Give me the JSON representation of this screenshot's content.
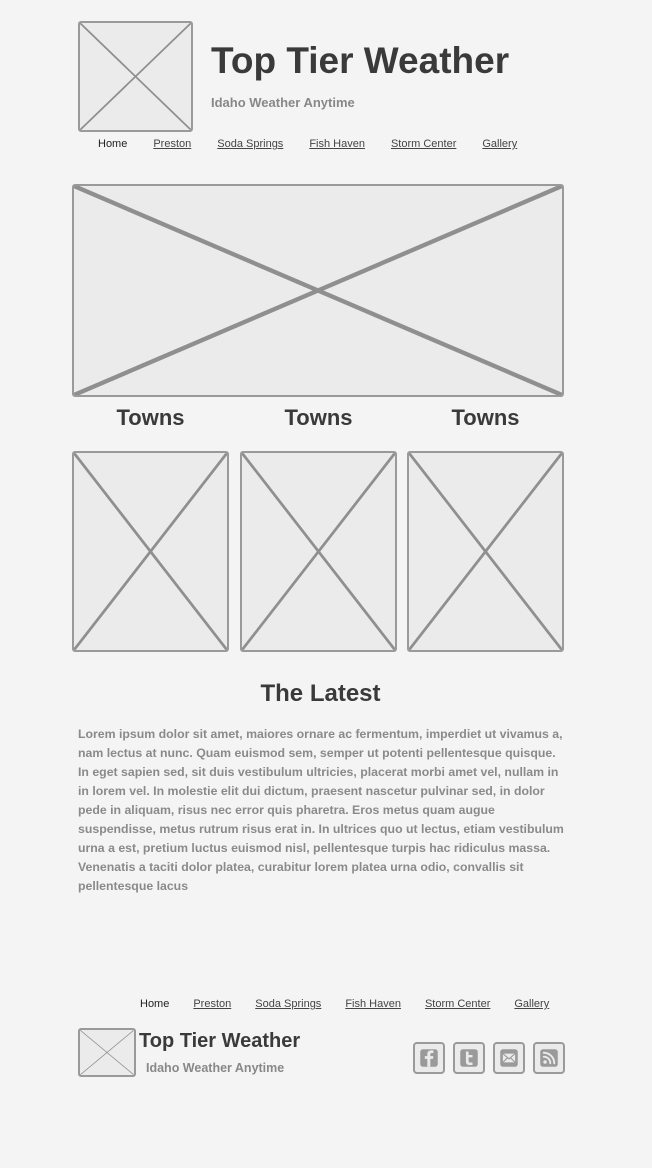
{
  "header": {
    "title": "Top Tier Weather",
    "subtitle": "Idaho Weather Anytime"
  },
  "nav": {
    "items": [
      "Home",
      "Preston",
      "Soda Springs",
      "Fish Haven",
      "Storm Center",
      "Gallery"
    ],
    "active": "Home"
  },
  "towns": {
    "labels": [
      "Towns",
      "Towns",
      "Towns"
    ]
  },
  "latest": {
    "title": "The Latest",
    "body": "Lorem ipsum dolor sit amet, maiores ornare ac fermentum, imperdiet ut vivamus a, nam lectus at nunc. Quam euismod sem, semper ut potenti pellentesque quisque. In eget sapien sed, sit duis vestibulum ultricies, placerat morbi amet vel, nullam in in lorem vel. In molestie elit dui dictum, praesent nascetur pulvinar sed, in dolor pede in aliquam, risus nec error quis pharetra. Eros metus quam augue suspendisse, metus rutrum risus erat in.  In ultrices quo ut lectus, etiam vestibulum urna a est, pretium luctus euismod nisl, pellentesque turpis hac ridiculus massa. Venenatis a taciti dolor platea, curabitur lorem platea urna odio, convallis sit pellentesque lacus"
  },
  "footer": {
    "title": "Top Tier Weather",
    "subtitle": "Idaho Weather Anytime",
    "social": [
      "facebook-icon",
      "twitter-icon",
      "mail-icon",
      "rss-icon"
    ]
  },
  "colors": {
    "background": "#f4f4f4",
    "placeholder_fill": "#ebebeb",
    "placeholder_stroke": "#9a9a9a",
    "heading": "#3a3a3a",
    "muted_text": "#888888"
  }
}
